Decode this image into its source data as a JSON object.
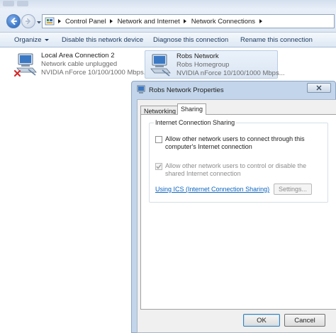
{
  "address_bar": {
    "crumbs": [
      "Control Panel",
      "Network and Internet",
      "Network Connections"
    ]
  },
  "toolbar": {
    "organize": "Organize",
    "disable": "Disable this network device",
    "diagnose": "Diagnose this connection",
    "rename": "Rename this connection"
  },
  "connections": [
    {
      "name": "Local Area Connection 2",
      "status": "Network cable unplugged",
      "adapter": "NVIDIA nForce 10/100/1000 Mbps..."
    },
    {
      "name": "Robs Network",
      "status": "Robs Homegroup",
      "adapter": "NVIDIA nForce 10/100/1000 Mbps..."
    }
  ],
  "dialog": {
    "title": "Robs Network Properties",
    "tabs": [
      "Networking",
      "Sharing"
    ],
    "group_label": "Internet Connection Sharing",
    "option_connect": [
      "Allow other network users to connect through this",
      "computer's Internet connection"
    ],
    "option_control": [
      "Allow other network users to control or disable the",
      "shared Internet connection"
    ],
    "link": "Using ICS (Internet Connection Sharing)",
    "settings": "Settings...",
    "ok": "OK",
    "cancel": "Cancel"
  },
  "colors": {
    "link": "#0b65c0",
    "accent": "#1f5fb8",
    "error": "#d62a2a"
  }
}
